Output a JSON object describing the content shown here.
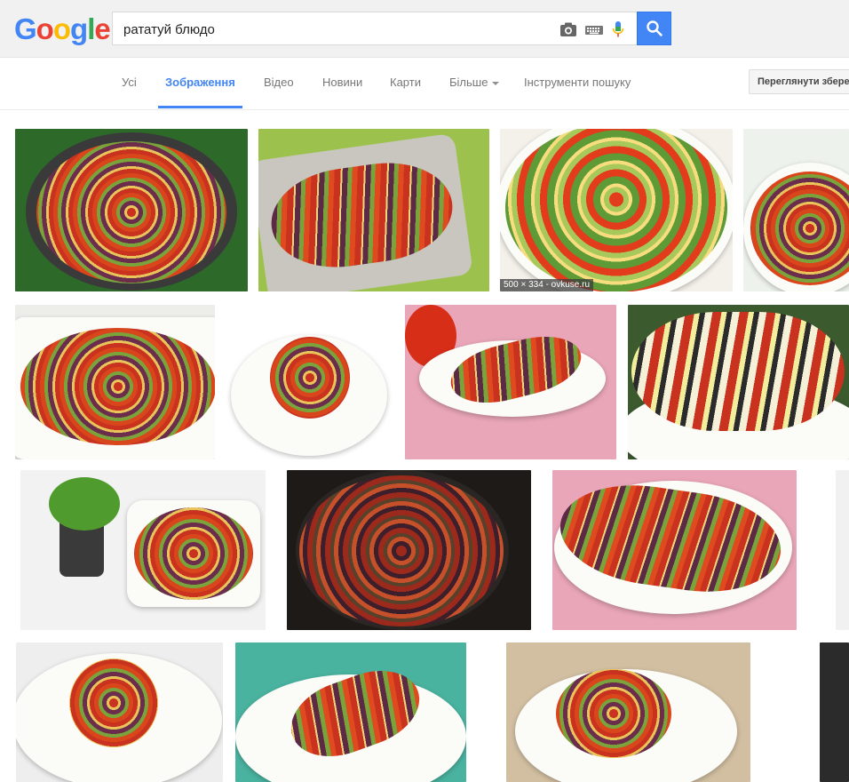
{
  "search": {
    "query": "рататуй блюдо"
  },
  "tabs": [
    {
      "label": "Усі"
    },
    {
      "label": "Зображення"
    },
    {
      "label": "Відео"
    },
    {
      "label": "Новини"
    },
    {
      "label": "Карти"
    },
    {
      "label": "Більше"
    },
    {
      "label": "Інструменти пошуку"
    }
  ],
  "saved_button": {
    "label": "Переглянути збережені"
  },
  "results": {
    "hover_label": "500 × 334 - ovkuse.ru"
  },
  "colors": {
    "accent": "#4285f4",
    "header_bg": "#f1f1f1",
    "tab_text": "#777777"
  }
}
